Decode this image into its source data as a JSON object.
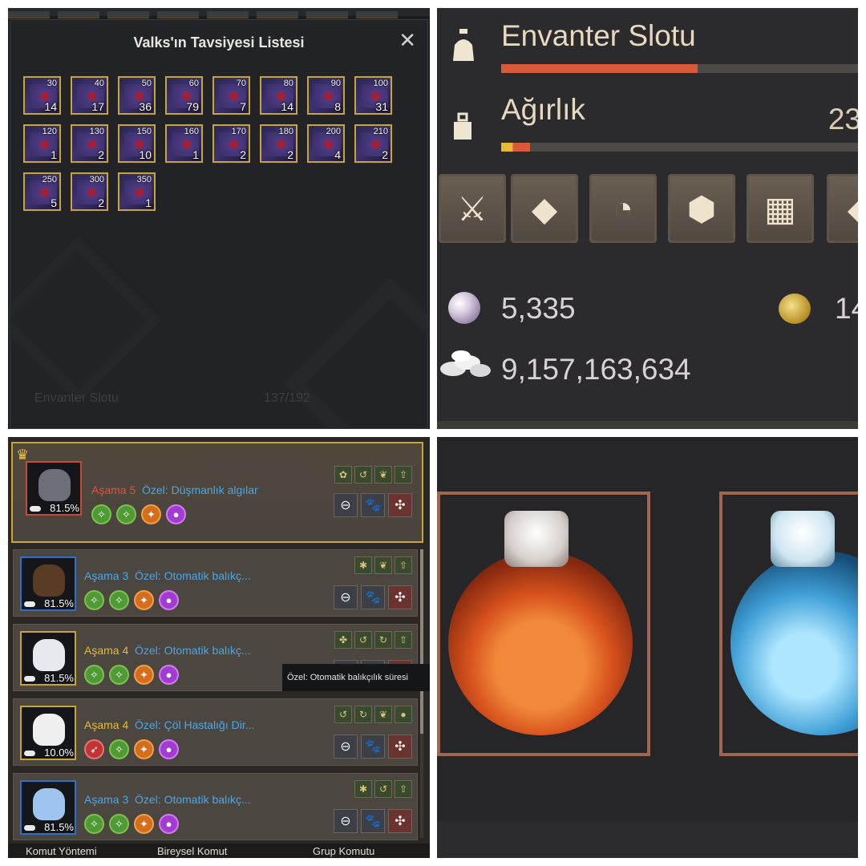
{
  "valks_panel": {
    "title": "Valks'ın Tavsiyesi Listesi",
    "close_glyph": "✕",
    "items": [
      {
        "level": "30",
        "count": "14"
      },
      {
        "level": "40",
        "count": "17"
      },
      {
        "level": "50",
        "count": "36"
      },
      {
        "level": "60",
        "count": "79"
      },
      {
        "level": "70",
        "count": "7"
      },
      {
        "level": "80",
        "count": "14"
      },
      {
        "level": "90",
        "count": "8"
      },
      {
        "level": "100",
        "count": "31"
      },
      {
        "level": "120",
        "count": "1"
      },
      {
        "level": "130",
        "count": "2"
      },
      {
        "level": "150",
        "count": "10"
      },
      {
        "level": "160",
        "count": "1"
      },
      {
        "level": "170",
        "count": "2"
      },
      {
        "level": "180",
        "count": "2"
      },
      {
        "level": "200",
        "count": "4"
      },
      {
        "level": "210",
        "count": "2"
      },
      {
        "level": "250",
        "count": "5"
      },
      {
        "level": "300",
        "count": "2"
      },
      {
        "level": "350",
        "count": "1"
      }
    ],
    "background_label": "Envanter Slotu",
    "background_value": "137/192"
  },
  "inventory_panel": {
    "slots_label": "Envanter Slotu",
    "slots_fill": 0.55,
    "weight_label": "Ağırlık",
    "weight_value": "23",
    "weight_fill": 0.08,
    "tabs": [
      {
        "icon": "sword-icon",
        "glyph": "⚔"
      },
      {
        "icon": "diamond-icon",
        "glyph": "◆"
      },
      {
        "icon": "accessory-icon",
        "glyph": "◔"
      },
      {
        "icon": "gem-icon",
        "glyph": "⬢"
      },
      {
        "icon": "grid-icon",
        "glyph": "▦"
      },
      {
        "icon": "misc-icon",
        "glyph": "◆"
      }
    ],
    "pearls": "5,335",
    "coins_partial": "14",
    "silver": "9,157,163,634",
    "accent_color": "#d85a3a"
  },
  "pets_panel": {
    "pets": [
      {
        "stage_label": "Aşama 5",
        "stage_color": "#e0523f",
        "special": "Özel: Düşmanlık algılar",
        "hunger": "81.5%",
        "frame": "red",
        "pet_color": "#6d6f78"
      },
      {
        "stage_label": "Aşama 3",
        "stage_color": "#4aa7e6",
        "special": "Özel: Otomatik balıkç...",
        "hunger": "81.5%",
        "frame": "blue",
        "pet_color": "#5a3b24"
      },
      {
        "stage_label": "Aşama 4",
        "stage_color": "#e6b93a",
        "special": "Özel: Otomatik balıkç...",
        "hunger": "81.5%",
        "frame": "gold",
        "pet_color": "#e8e8ef"
      },
      {
        "stage_label": "Aşama 4",
        "stage_color": "#e6b93a",
        "special": "Özel: Çöl Hastalığı Dir...",
        "hunger": "10.0%",
        "frame": "gold",
        "pet_color": "#f0f0f0"
      },
      {
        "stage_label": "Aşama 3",
        "stage_color": "#4aa7e6",
        "special": "Özel: Otomatik balıkç...",
        "hunger": "81.5%",
        "frame": "blue",
        "pet_color": "#9fc4ef"
      }
    ],
    "tooltip": "Özel: Otomatik balıkçılık süresi",
    "footer": {
      "left": "Komut Yöntemi",
      "middle": "Bireysel Komut",
      "right": "Grup Komutu"
    }
  },
  "potions_panel": {
    "potions": [
      {
        "name": "hp-potion",
        "color": "#d9531e"
      },
      {
        "name": "mp-potion",
        "color": "#3f9fd6"
      }
    ],
    "frame_color": "#a0674f"
  }
}
